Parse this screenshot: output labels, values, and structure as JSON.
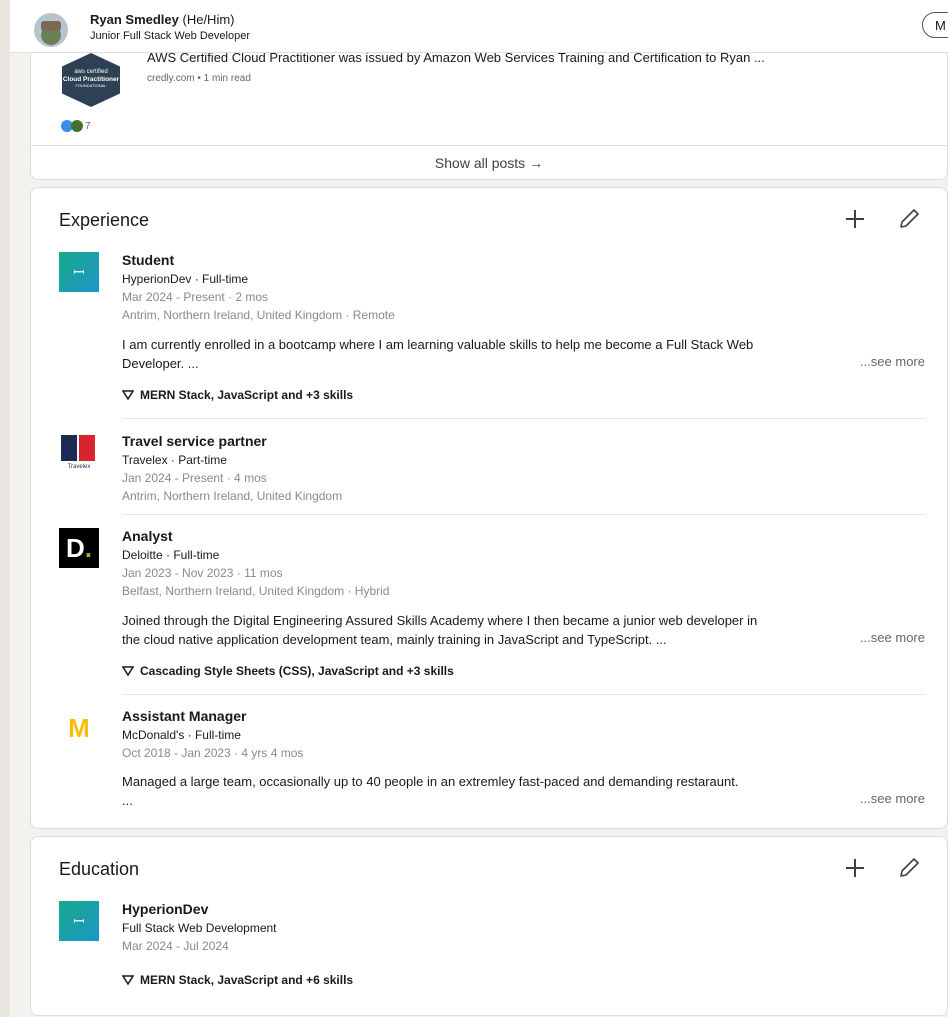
{
  "sticky": {
    "name": "Ryan Smedley",
    "pronouns": "(He/Him)",
    "headline": "Junior Full Stack Web Developer",
    "more_button": "M"
  },
  "posts": {
    "badge_line1": "aws certified",
    "badge_line2": "Cloud Practitioner",
    "badge_line3": "FOUNDATIONAL",
    "title": "AWS Certified Cloud Practitioner was issued by Amazon Web Services Training and Certification to Ryan ...",
    "meta": "credly.com • 1 min read",
    "reaction_count": "7",
    "show_all": "Show all posts →"
  },
  "experience": {
    "title": "Experience",
    "items": [
      {
        "role": "Student",
        "org": "HyperionDev · Full-time",
        "dates": "Mar 2024 - Present · 2 mos",
        "location": "Antrim, Northern Ireland, United Kingdom · Remote",
        "desc_line1": "I am currently enrolled in a bootcamp where I am learning valuable skills to help me become a Full Stack Web",
        "desc_line2": "Developer. ...",
        "see_more": "...see more",
        "skills": "MERN Stack, JavaScript and +3 skills"
      },
      {
        "role": "Travel service partner",
        "org": "Travelex · Part-time",
        "dates": "Jan 2024 - Present · 4 mos",
        "location": "Antrim, Northern Ireland, United Kingdom",
        "logo_text": "Travelex"
      },
      {
        "role": "Analyst",
        "org": "Deloitte · Full-time",
        "dates": "Jan 2023 - Nov 2023 · 11 mos",
        "location": "Belfast, Northern Ireland, United Kingdom · Hybrid",
        "desc_line1": "Joined through the Digital Engineering Assured Skills Academy where I then became a junior web developer in",
        "desc_line2": "the cloud native application development team, mainly training in JavaScript and TypeScript. ...",
        "see_more": "...see more",
        "skills": "Cascading Style Sheets (CSS), JavaScript and +3 skills"
      },
      {
        "role": "Assistant Manager",
        "org": "McDonald's · Full-time",
        "dates": "Oct 2018 - Jan 2023 · 4 yrs 4 mos",
        "desc_line1": "Managed a large team, occasionally up to 40 people in an extremley fast-paced and demanding restaraunt.",
        "desc_line2": "...",
        "see_more": "...see more"
      }
    ]
  },
  "education": {
    "title": "Education",
    "school": "HyperionDev",
    "course": "Full Stack Web Development",
    "dates": "Mar 2024 - Jul 2024",
    "skills": "MERN Stack, JavaScript and +6 skills"
  }
}
